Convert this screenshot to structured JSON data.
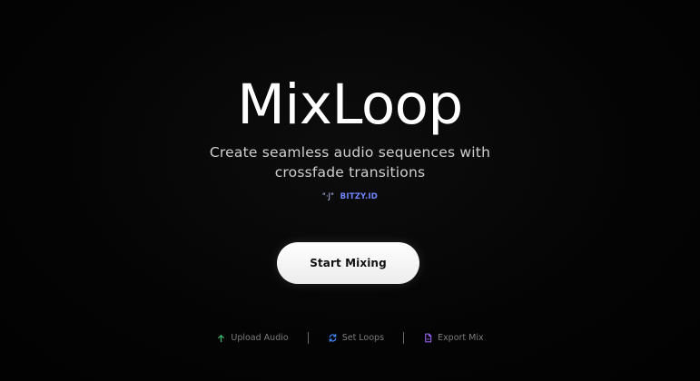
{
  "app": {
    "title": "MixLoop",
    "subtitle": "Create seamless audio sequences with crossfade transitions"
  },
  "brand": {
    "mark": "\"·J\"",
    "name": "BITZY.ID",
    "color": "#6f86ff"
  },
  "cta": {
    "start_label": "Start Mixing"
  },
  "features": [
    {
      "label": "Upload Audio",
      "icon": "upload-icon",
      "color": "#3fbf6f"
    },
    {
      "label": "Set Loops",
      "icon": "loop-icon",
      "color": "#3f8cff"
    },
    {
      "label": "Export Mix",
      "icon": "file-icon",
      "color": "#a56bff"
    }
  ]
}
